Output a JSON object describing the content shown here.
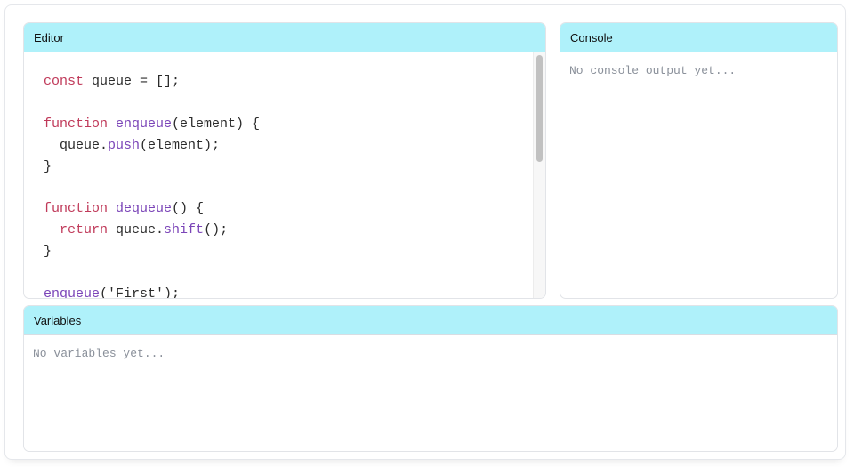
{
  "editor": {
    "title": "Editor",
    "lines": [
      [
        {
          "t": "const",
          "c": "kw"
        },
        {
          "t": " queue = [];",
          "c": "plain"
        }
      ],
      [],
      [
        {
          "t": "function",
          "c": "kw"
        },
        {
          "t": " ",
          "c": "plain"
        },
        {
          "t": "enqueue",
          "c": "fn"
        },
        {
          "t": "(element) {",
          "c": "plain"
        }
      ],
      [
        {
          "t": "  queue.",
          "c": "plain"
        },
        {
          "t": "push",
          "c": "fn"
        },
        {
          "t": "(element);",
          "c": "plain"
        }
      ],
      [
        {
          "t": "}",
          "c": "plain"
        }
      ],
      [],
      [
        {
          "t": "function",
          "c": "kw"
        },
        {
          "t": " ",
          "c": "plain"
        },
        {
          "t": "dequeue",
          "c": "fn"
        },
        {
          "t": "() {",
          "c": "plain"
        }
      ],
      [
        {
          "t": "  ",
          "c": "plain"
        },
        {
          "t": "return",
          "c": "kw"
        },
        {
          "t": " queue.",
          "c": "plain"
        },
        {
          "t": "shift",
          "c": "fn"
        },
        {
          "t": "();",
          "c": "plain"
        }
      ],
      [
        {
          "t": "}",
          "c": "plain"
        }
      ],
      [],
      [
        {
          "t": "enqueue",
          "c": "fn"
        },
        {
          "t": "('First');",
          "c": "plain"
        }
      ]
    ]
  },
  "console": {
    "title": "Console",
    "placeholder": "No console output yet..."
  },
  "variables": {
    "title": "Variables",
    "placeholder": "No variables yet..."
  },
  "colors": {
    "header_bg": "#aff1fa",
    "keyword": "#c03a5a",
    "function": "#7b45b8",
    "placeholder": "#8a909a"
  }
}
